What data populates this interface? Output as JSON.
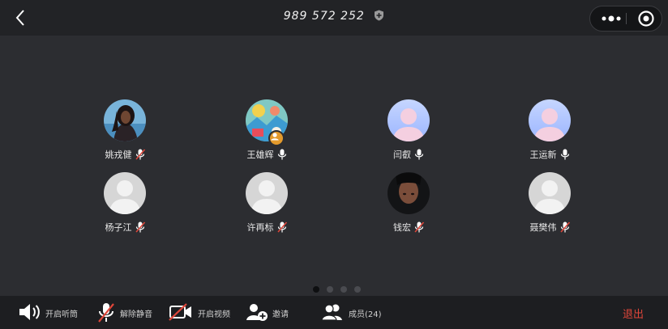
{
  "header": {
    "meeting_id": "989 572 252",
    "icons": {
      "back": "chevron-left-icon",
      "secure": "shield-icon",
      "more": "more-dots-icon",
      "close": "target-circle-icon"
    }
  },
  "participants": [
    {
      "name": "姚戎健",
      "mic": "muted",
      "avatar": "photo-woman"
    },
    {
      "name": "王雄辉",
      "mic": "on",
      "avatar": "photo-cartoon",
      "host_badge": true
    },
    {
      "name": "闫叡",
      "mic": "on",
      "avatar": "placeholder-blue"
    },
    {
      "name": "王运新",
      "mic": "on",
      "avatar": "placeholder-blue"
    },
    {
      "name": "杨子江",
      "mic": "muted",
      "avatar": "placeholder-gray"
    },
    {
      "name": "许再标",
      "mic": "muted",
      "avatar": "placeholder-gray"
    },
    {
      "name": "钱宏",
      "mic": "muted",
      "avatar": "photo-dark"
    },
    {
      "name": "聂樊伟",
      "mic": "muted",
      "avatar": "placeholder-gray"
    }
  ],
  "pagination": {
    "pages": 4,
    "current": 1
  },
  "toolbar": {
    "speaker": "开启听筒",
    "unmute": "解除静音",
    "video": "开启视频",
    "invite": "邀请",
    "members": "成员(24)",
    "exit": "退出"
  },
  "colors": {
    "background": "#2c2d31",
    "bar": "#1d1e21",
    "exit": "#e0463a",
    "badge": "#e39a2c"
  }
}
